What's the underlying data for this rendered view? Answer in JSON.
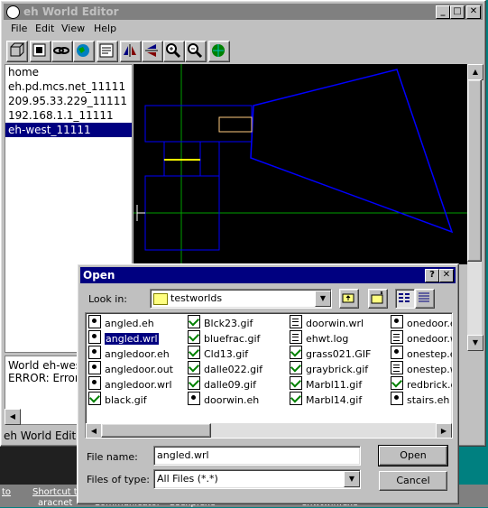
{
  "main_window": {
    "title": "eh World Editor",
    "menu": [
      "File",
      "Edit",
      "View",
      "Help"
    ],
    "toolbar": [
      "cube-icon",
      "box-icon",
      "link-icon",
      "globe-icon",
      "properties-icon",
      "mirror-icon",
      "flip-icon",
      "zoom-in-icon",
      "zoom-out-icon",
      "world-icon"
    ],
    "servers": [
      "home",
      "eh.pd.mcs.net_11111",
      "209.95.33.229_11111",
      "192.168.1.1_11111",
      "eh-west_11111"
    ],
    "selected_server": "eh-west_11111",
    "log_lines": [
      "World eh-wes",
      "ERROR: Error"
    ],
    "status": "eh World Edito"
  },
  "dialog": {
    "title": "Open",
    "help_button": "?",
    "close_button": "✕",
    "look_in_label": "Look in:",
    "look_in_value": "testworlds",
    "files": [
      {
        "name": "angled.eh",
        "type": "eh"
      },
      {
        "name": "angled.wrl",
        "type": "eh",
        "selected": true
      },
      {
        "name": "angledoor.eh",
        "type": "eh"
      },
      {
        "name": "angledoor.out",
        "type": "eh"
      },
      {
        "name": "angledoor.wrl",
        "type": "eh"
      },
      {
        "name": "black.gif",
        "type": "gif"
      },
      {
        "name": "Blck23.gif",
        "type": "gif"
      },
      {
        "name": "bluefrac.gif",
        "type": "gif"
      },
      {
        "name": "Cld13.gif",
        "type": "gif"
      },
      {
        "name": "dalle022.gif",
        "type": "gif"
      },
      {
        "name": "dalle09.gif",
        "type": "gif"
      },
      {
        "name": "doorwin.eh",
        "type": "eh"
      },
      {
        "name": "doorwin.wrl",
        "type": "txt"
      },
      {
        "name": "ehwt.log",
        "type": "txt"
      },
      {
        "name": "grass021.GIF",
        "type": "gif"
      },
      {
        "name": "graybrick.gif",
        "type": "gif"
      },
      {
        "name": "Marbl11.gif",
        "type": "gif"
      },
      {
        "name": "Marbl14.gif",
        "type": "gif"
      },
      {
        "name": "onedoor.el",
        "type": "eh"
      },
      {
        "name": "onedoor.w",
        "type": "txt"
      },
      {
        "name": "onestep.el",
        "type": "eh"
      },
      {
        "name": "onestep.w",
        "type": "txt"
      },
      {
        "name": "redbrick.gi",
        "type": "gif"
      },
      {
        "name": "stairs.eh",
        "type": "eh"
      }
    ],
    "file_name_label": "File name:",
    "file_name_value": "angled.wrl",
    "file_type_label": "Files of type:",
    "file_type_value": "All Files (*.*)",
    "open_button": "Open",
    "cancel_button": "Cancel"
  },
  "taskbar": {
    "items": [
      "to",
      "Shortcut to",
      "aracnet",
      "Communicator",
      "Ssexp.exe",
      "ehwtwin.exe"
    ]
  }
}
